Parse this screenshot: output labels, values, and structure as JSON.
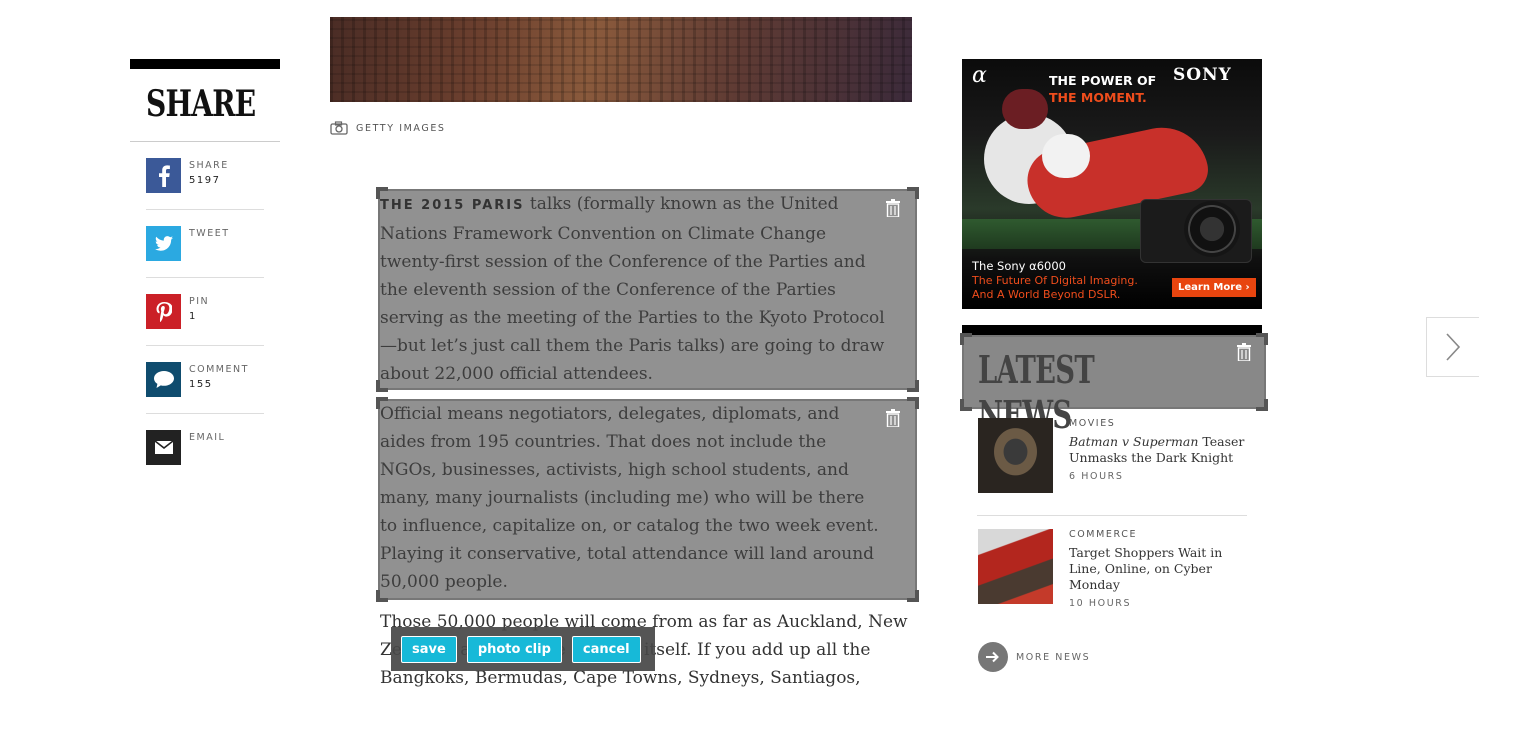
{
  "hero": {
    "credit": "GETTY IMAGES",
    "camera_icon": "camera-icon"
  },
  "share": {
    "title": "SHARE",
    "items": [
      {
        "label": "SHARE",
        "count": "5197",
        "icon": "facebook-icon",
        "color": "#3b5998"
      },
      {
        "label": "TWEET",
        "count": "",
        "icon": "twitter-icon",
        "color": "#2ba9e1"
      },
      {
        "label": "PIN",
        "count": "1",
        "icon": "pinterest-icon",
        "color": "#cb2027"
      },
      {
        "label": "COMMENT",
        "count": "155",
        "icon": "comment-icon",
        "color": "#0f4c6e"
      },
      {
        "label": "EMAIL",
        "count": "",
        "icon": "email-icon",
        "color": "#222222"
      }
    ]
  },
  "article": {
    "p1_lead": "THE 2015 PARIS",
    "p1_rest": " talks (formally known as the United Nations Framework Convention on Climate Change twenty-first session of the Conference of the Parties and the eleventh session of the Conference of the Parties serving as the meeting of the Parties to the Kyoto Protocol—but let’s just call them the Paris talks) are going to draw about 22,000 official attendees.",
    "p2": "Official means negotiators, delegates, diplomats, and aides from 195 countries. That does not include the NGOs, businesses, activists, high school students, and many, many journalists (including me) who will be there to influence, capitalize on, or catalog the two week event. Playing it conservative, total attendance will land around 50,000 people.",
    "p3": "Those 50,000 people will come from as far as Auckland, New Zealand, and as close as Paris itself. If you add up all the Bangkoks, Bermudas, Cape Towns, Sydneys, Santiagos,"
  },
  "toolbar": {
    "save": "save",
    "photo_clip": "photo clip",
    "cancel": "cancel",
    "accent": "#17b9d8"
  },
  "ad": {
    "alpha": "α",
    "headline1": "THE POWER OF",
    "headline2": "THE MOMENT.",
    "brand": "SONY",
    "model": "The Sony α6000",
    "tagline1": "The Future Of Digital Imaging.",
    "tagline2": "And A World Beyond DSLR.",
    "cta": "Learn More ›",
    "accent": "#e8450f"
  },
  "news": {
    "title": "LATEST NEWS",
    "items": [
      {
        "category": "MOVIES",
        "headline_em": "Batman v Superman",
        "headline": " Teaser Unmasks the Dark Knight",
        "time": "6 HOURS"
      },
      {
        "category": "COMMERCE",
        "headline_em": "",
        "headline": "Target Shoppers Wait in Line, Online, on Cyber Monday",
        "time": "10 HOURS"
      }
    ],
    "more": "MORE NEWS"
  }
}
